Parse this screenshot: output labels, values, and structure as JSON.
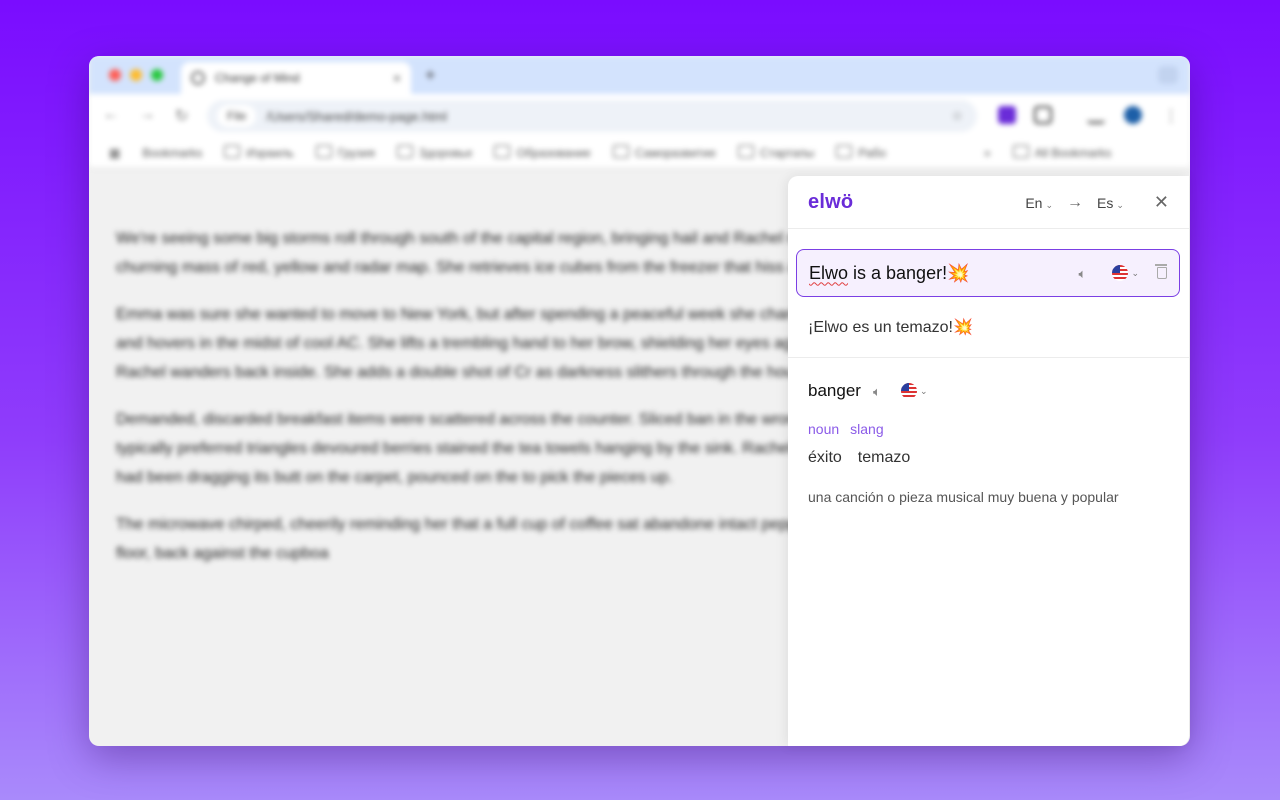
{
  "browser": {
    "tab_title": "Change of Mind",
    "address_chip": "File",
    "address": "/Users/Shared/demo-page.html",
    "bookmarks": [
      "Bookmarks",
      "Израиль",
      "Грузия",
      "Здоровье",
      "Образование",
      "Саморазвитие",
      "Стартапы",
      "Рабо"
    ],
    "all_bookmarks": "All Bookmarks",
    "overflow": "»"
  },
  "page": {
    "paragraphs": [
      "We're seeing some big storms roll through south of the capital region, bringing hail and Rachel mutes the forecaster waving his arms at the churning mass of red, yellow and radar map. She retrieves ice cubes from the freezer that hiss and spit with displeasure ginger ale.",
      "Emma was sure she wanted to move to New York, but after spending a peaceful week she changed her mind. She slides the patio door aside and hovers in the midst of cool AC. She lifts a trembling hand to her brow, shielding her eyes against the hazy across the golden crops, Rachel wanders back inside. She adds a double shot of Cr as darkness slithers through the house.",
      "Demanded, discarded breakfast items were scattered across the counter. Sliced ban in the wrong green bowl. A waffle dismembered into the typically preferred triangles devoured berries stained the tea towels hanging by the sink. Rachel fetched another sized pieces. The dog, who had been dragging its butt on the carpet, pounced on the to pick the pieces up.",
      "The microwave chirped, cheerily reminding her that a full cup of coffee sat abandone intact pepperoni stick, she'd sunk down to the kitchen floor, back against the cupboa"
    ]
  },
  "translator": {
    "logo": "elwö",
    "source_lang": "En",
    "target_lang": "Es",
    "input_word1": "Elwo",
    "input_rest": " is a banger!💥",
    "translation": "¡Elwo es un temazo!💥",
    "word": "banger",
    "tags": [
      "noun",
      "slang"
    ],
    "synonyms": [
      "éxito",
      "temazo"
    ],
    "definition": "una canción o pieza musical muy buena y popular"
  },
  "colors": {
    "accent": "#6a2cd8",
    "tag": "#8b5be8",
    "input_border": "#7b3fe4",
    "input_bg": "#f6f0fe"
  }
}
